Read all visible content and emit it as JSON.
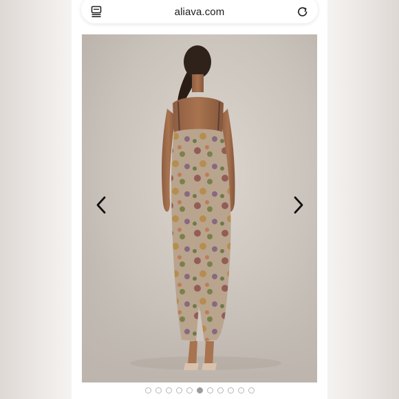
{
  "browser": {
    "url": "aliava.com",
    "tabs_icon": "tabs-icon",
    "reload_icon": "reload-icon"
  },
  "gallery": {
    "image_subject": "product-photo",
    "prev_icon": "chevron-left-icon",
    "next_icon": "chevron-right-icon",
    "dot_count": 11,
    "active_index": 5
  },
  "colors": {
    "background": "#cbc4bd",
    "dot_active": "#9c9c9c",
    "dot_inactive": "#ffffff"
  }
}
